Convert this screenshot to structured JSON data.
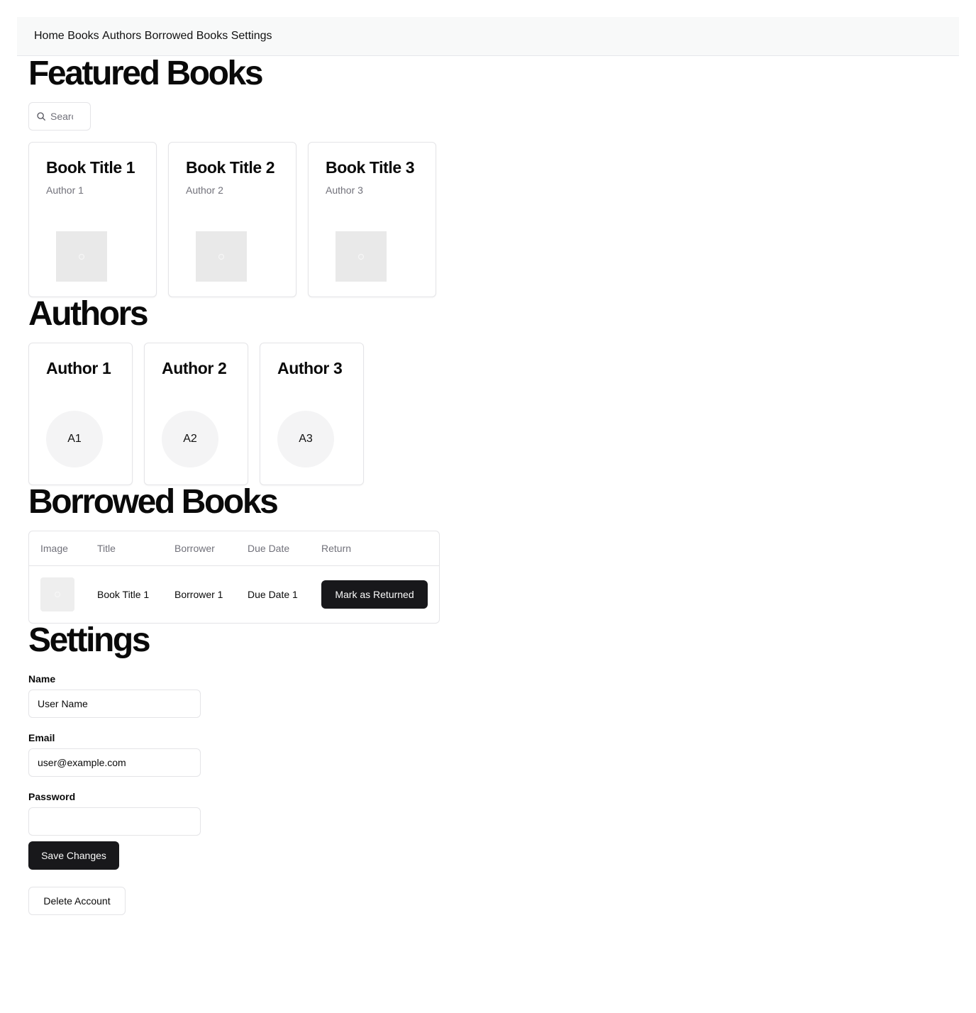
{
  "nav": {
    "items": [
      "Home",
      "Books",
      "Authors",
      "Borrowed Books",
      "Settings"
    ]
  },
  "featured": {
    "title": "Featured Books",
    "search_placeholder": "Search",
    "books": [
      {
        "title": "Book Title 1",
        "author": "Author 1"
      },
      {
        "title": "Book Title 2",
        "author": "Author 2"
      },
      {
        "title": "Book Title 3",
        "author": "Author 3"
      }
    ]
  },
  "authors": {
    "title": "Authors",
    "items": [
      {
        "name": "Author 1",
        "initials": "A1"
      },
      {
        "name": "Author 2",
        "initials": "A2"
      },
      {
        "name": "Author 3",
        "initials": "A3"
      }
    ]
  },
  "borrowed": {
    "title": "Borrowed Books",
    "columns": [
      "Image",
      "Title",
      "Borrower",
      "Due Date",
      "Return"
    ],
    "rows": [
      {
        "title": "Book Title 1",
        "borrower": "Borrower 1",
        "due_date": "Due Date 1",
        "action_label": "Mark as Returned"
      }
    ]
  },
  "settings": {
    "title": "Settings",
    "name_label": "Name",
    "name_value": "User Name",
    "email_label": "Email",
    "email_value": "user@example.com",
    "password_label": "Password",
    "password_value": "",
    "save_label": "Save Changes",
    "delete_label": "Delete Account"
  },
  "icons": {
    "search": "search-icon",
    "image_placeholder": "image-placeholder-icon"
  },
  "colors": {
    "primary": "#18181b",
    "muted_text": "#71717a",
    "border": "#e4e4e7",
    "nav_bg": "#f8f9f9"
  }
}
